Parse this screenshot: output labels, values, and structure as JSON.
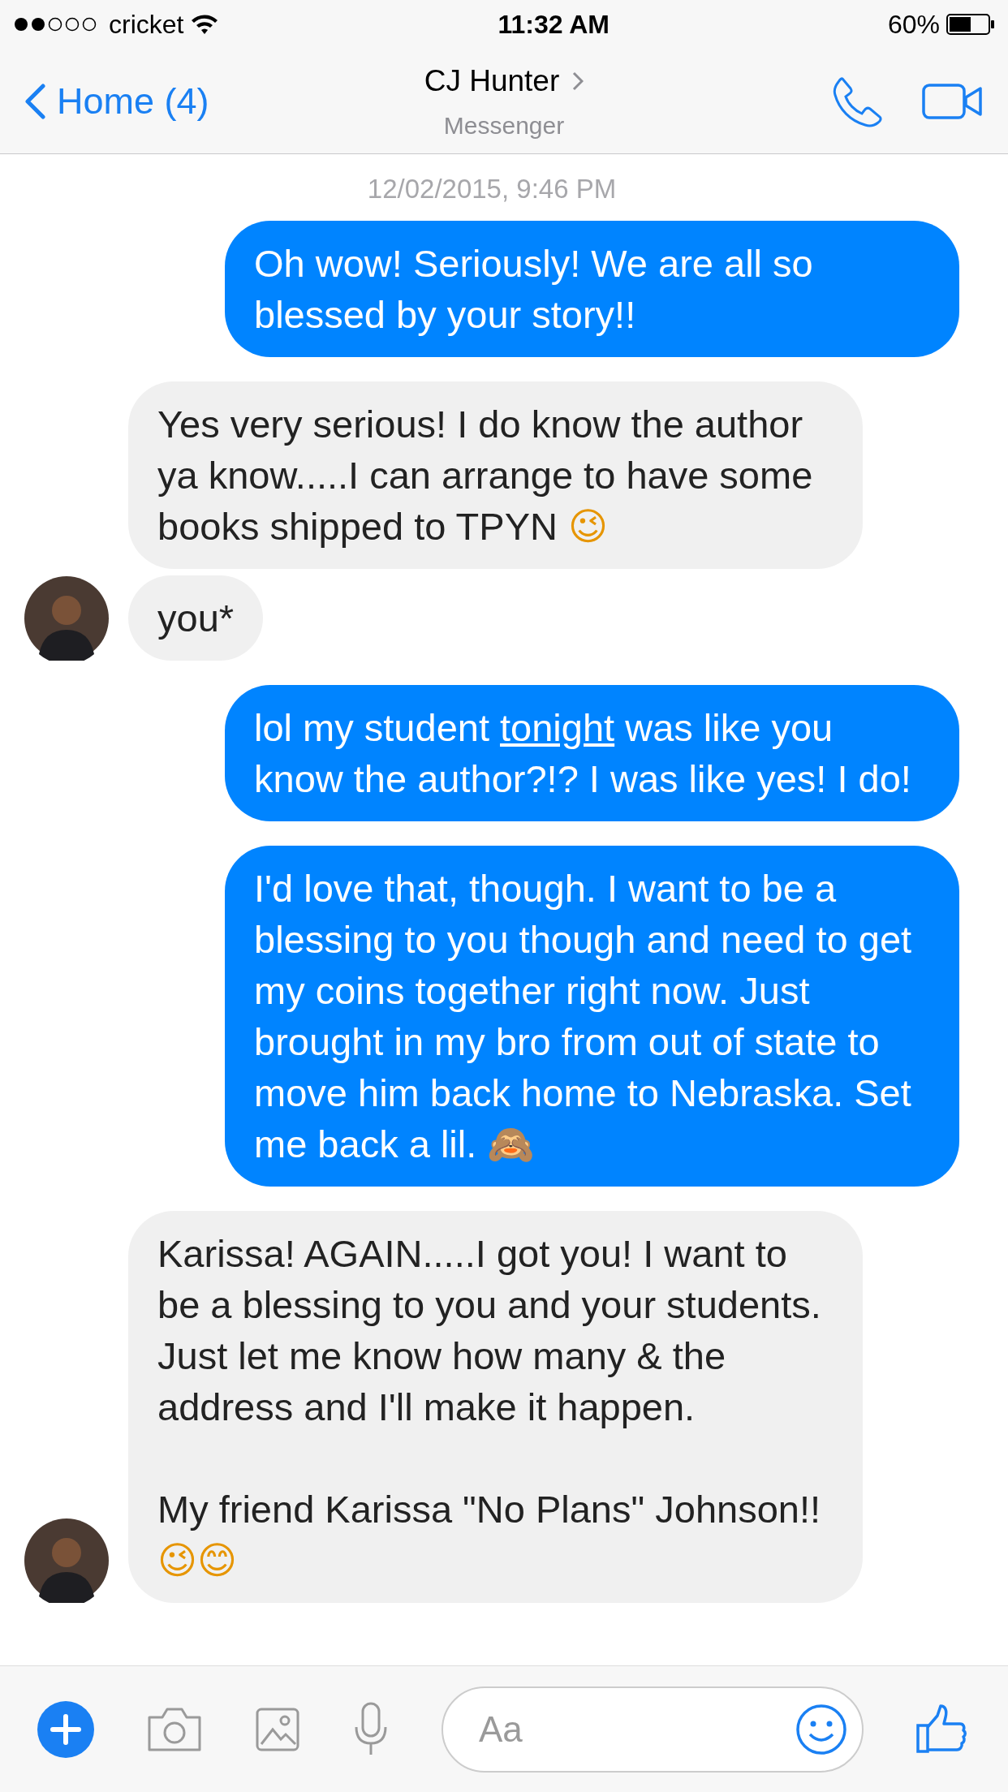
{
  "status_bar": {
    "carrier": "cricket",
    "time": "11:32 AM",
    "battery": "60%"
  },
  "header": {
    "back": "Home (4)",
    "title": "CJ Hunter",
    "subtitle": "Messenger"
  },
  "timestamp": "12/02/2015, 9:46 PM",
  "messages": [
    {
      "kind": "outgoing",
      "text": "Oh wow! Seriously! We are all so blessed by your story!!"
    },
    {
      "kind": "incoming",
      "avatar": false,
      "text": "Yes very serious! I do know the author ya know.....I can arrange to have some books shipped to TPYN 😉"
    },
    {
      "kind": "incoming",
      "avatar": true,
      "text": "you*"
    },
    {
      "kind": "outgoing",
      "parts": [
        {
          "text": "lol my student "
        },
        {
          "text": "tonight",
          "link": true
        },
        {
          "text": " was like you know the author?!? I was like yes! I do!"
        }
      ]
    },
    {
      "kind": "outgoing",
      "text": "I'd love that, though. I want to be a blessing to you though and need to get my coins together right now. Just brought in my bro from out of state to move him back home to Nebraska. Set me back a lil. 🙈"
    },
    {
      "kind": "incoming",
      "avatar": true,
      "text": "Karissa! AGAIN.....I got you! I want to be a blessing to you and your students. Just let me know how many & the address and I'll make it happen.\n\nMy friend Karissa \"No Plans\" Johnson!! 😉😊"
    }
  ],
  "composer": {
    "placeholder": "Aa"
  }
}
